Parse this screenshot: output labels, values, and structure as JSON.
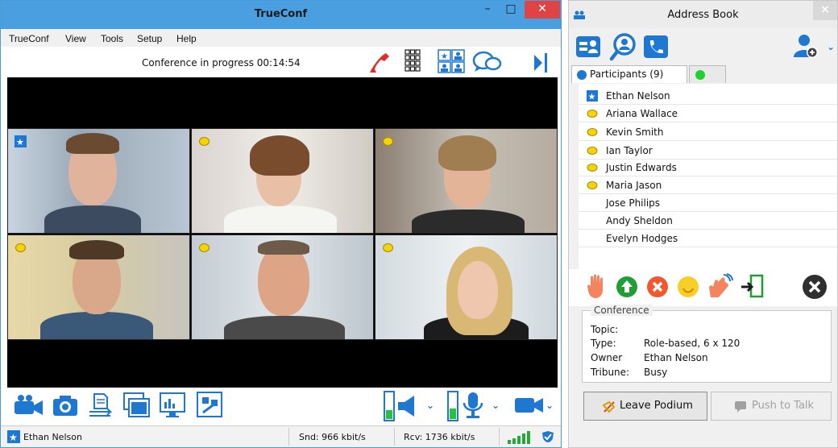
{
  "main_window": {
    "title": "TrueConf",
    "controls": {
      "minimize": "–",
      "maximize": "□",
      "close": "✕"
    }
  },
  "menu": [
    "TrueConf",
    "View",
    "Tools",
    "Setup",
    "Help"
  ],
  "toolbar": {
    "status": "Conference in progress 00:14:54",
    "icons": [
      "hangup-icon",
      "dialpad-icon",
      "layout-icon",
      "chat-icon",
      "collapse-panel-icon"
    ]
  },
  "video_tiles": [
    {
      "badge": "star"
    },
    {
      "badge": "speaker"
    },
    {
      "badge": "speaker"
    },
    {
      "badge": "speaker"
    },
    {
      "badge": "speaker"
    },
    {
      "badge": "speaker"
    }
  ],
  "bottom_toolbar": {
    "icons": [
      "camera-icon",
      "snapshot-icon",
      "share-file-icon",
      "window-share-icon",
      "screen-share-icon",
      "whiteboard-icon",
      "speaker-volume-icon",
      "microphone-icon",
      "video-camera-icon"
    ]
  },
  "statusbar": {
    "user": "Ethan Nelson",
    "send": "Snd: 966 kbit/s",
    "receive": "Rcv: 1736 kbit/s"
  },
  "address_book": {
    "title": "Address Book",
    "close": "×",
    "tabs": [
      "contacts-icon",
      "search-icon",
      "call-icon"
    ],
    "list_tab_label": "Participants (9)",
    "participants": [
      {
        "name": "Ethan Nelson",
        "role": "star"
      },
      {
        "name": "Ariana Wallace",
        "role": "speaker"
      },
      {
        "name": "Kevin Smith",
        "role": "speaker"
      },
      {
        "name": "Ian Taylor",
        "role": "speaker"
      },
      {
        "name": "Justin Edwards",
        "role": "speaker"
      },
      {
        "name": "Maria Jason",
        "role": "speaker"
      },
      {
        "name": "Jose Philips",
        "role": "none"
      },
      {
        "name": "Andy Sheldon",
        "role": "none"
      },
      {
        "name": "Evelyn Hodges",
        "role": "none"
      }
    ],
    "conference": {
      "legend": "Conference",
      "topic_label": "Topic:",
      "topic_value": "",
      "type_label": "Type:",
      "type_value": "Role-based, 6 x 120",
      "owner_label": "Owner",
      "owner_value": "Ethan Nelson",
      "tribune_label": "Tribune:",
      "tribune_value": "Busy"
    },
    "leave_podium": "Leave Podium",
    "push_to_talk": "Push to Talk"
  },
  "colors": {
    "accent": "#1e78d2",
    "titlebar": "#4a9fe0",
    "close": "#e04343"
  }
}
